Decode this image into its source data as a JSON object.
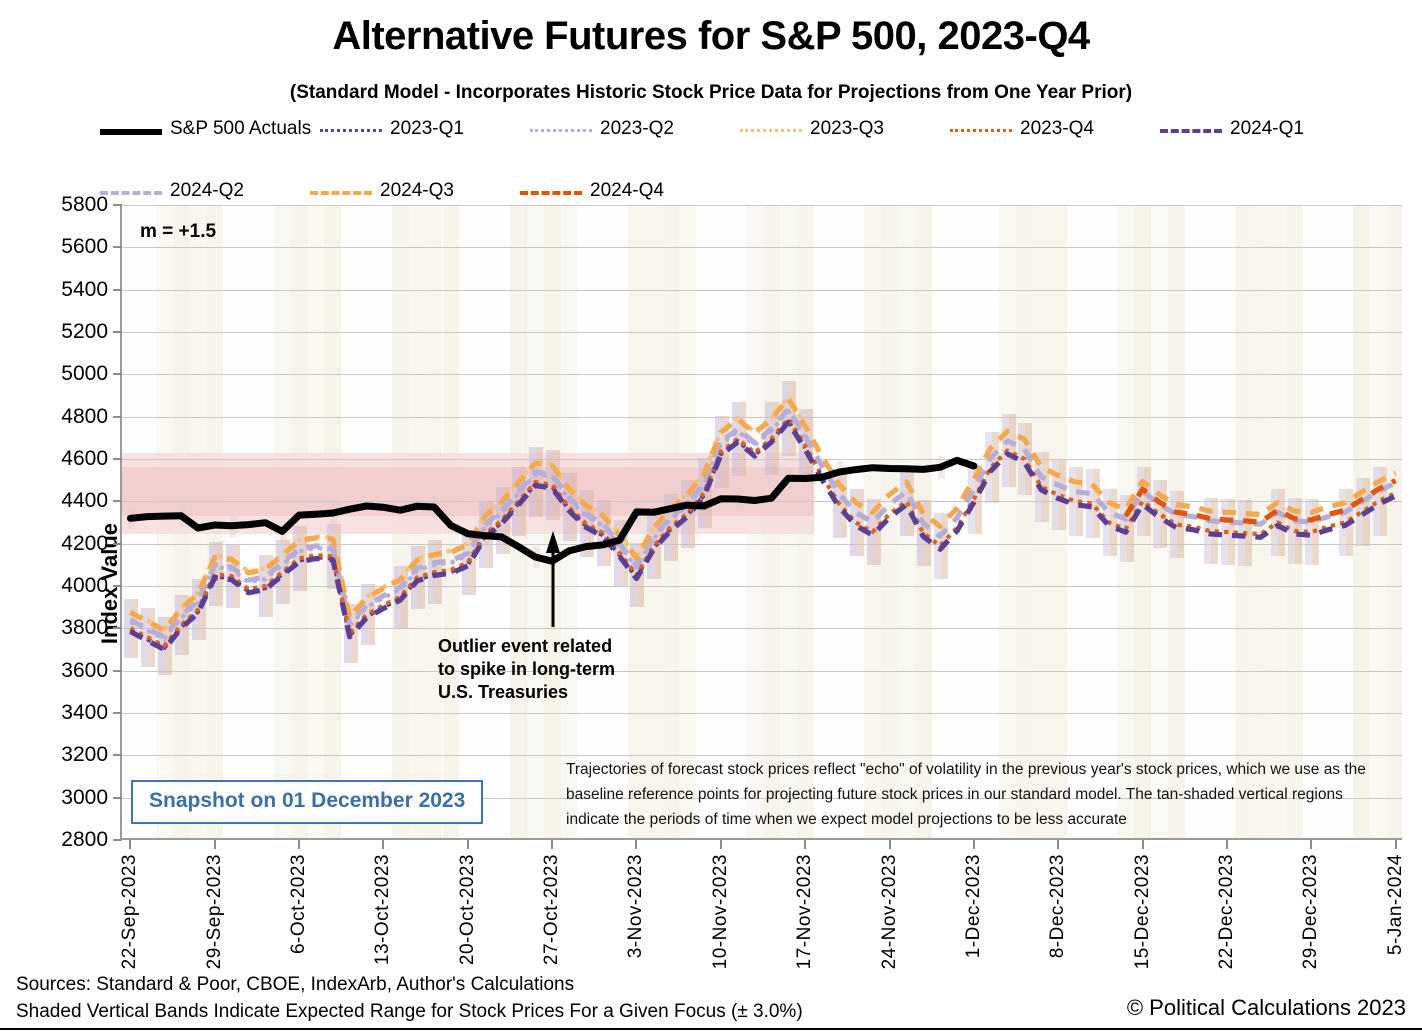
{
  "header": {
    "title": "Alternative Futures for S&P 500, 2023-Q4",
    "subtitle": "(Standard Model - Incorporates Historic Stock Price Data for Projections from One Year Prior)"
  },
  "legend": {
    "rows": [
      [
        {
          "label": "S&P 500 Actuals",
          "color": "#000000",
          "style": "solid",
          "width": 6
        },
        {
          "label": "2023-Q1",
          "color": "#5b3e96",
          "style": "dotted",
          "width": 3
        },
        {
          "label": "2023-Q2",
          "color": "#b5aedb",
          "style": "dotted",
          "width": 3
        },
        {
          "label": "2023-Q3",
          "color": "#f7c177",
          "style": "dotted",
          "width": 3
        },
        {
          "label": "2023-Q4",
          "color": "#e2600e",
          "style": "dotted",
          "width": 3
        },
        {
          "label": "2024-Q1",
          "color": "#5b3e96",
          "style": "dashed",
          "width": 4
        }
      ],
      [
        {
          "label": "2024-Q2",
          "color": "#b5aedb",
          "style": "dashed",
          "width": 4
        },
        {
          "label": "2024-Q3",
          "color": "#f5a84e",
          "style": "dashed",
          "width": 4
        },
        {
          "label": "2024-Q4",
          "color": "#e2540c",
          "style": "dashed",
          "width": 4
        }
      ]
    ]
  },
  "annotations": {
    "slope_label": "m = +1.5",
    "callout": "Outlier event related\nto spike in long-term\nU.S. Treasuries",
    "callout_line1": "Outlier event related",
    "callout_line2": "to spike in long-term",
    "callout_line3": "U.S. Treasuries",
    "snapshot": "Snapshot on 01 December 2023",
    "note": "Trajectories of forecast stock prices reflect \"echo\" of volatility in  the previous year's stock prices, which we use as the baseline reference points for projecting future stock prices in our standard model.   The tan-shaded vertical regions indicate the periods of time when we expect model projections to be less accurate"
  },
  "footer": {
    "line1": "Sources: Standard & Poor, CBOE, IndexArb, Author's Calculations",
    "line2": "Shaded Vertical Bands Indicate Expected Range for Stock Prices For a Given Focus (± 3.0%)",
    "copyright": "© Political Calculations 2023"
  },
  "chart_data": {
    "type": "line",
    "title": "Alternative Futures for S&P 500, 2023-Q4",
    "subtitle": "(Standard Model - Incorporates Historic Stock Price Data for Projections from One Year Prior)",
    "xlabel": "",
    "ylabel": "Index Value",
    "ylim": [
      2800,
      5800
    ],
    "yticks": [
      2800,
      3000,
      3200,
      3400,
      3600,
      3800,
      4000,
      4200,
      4400,
      4600,
      4800,
      5000,
      5200,
      5400,
      5600,
      5800
    ],
    "grid": true,
    "legend_position": "top",
    "xtick_labels": [
      "22-Sep-2023",
      "29-Sep-2023",
      "6-Oct-2023",
      "13-Oct-2023",
      "20-Oct-2023",
      "27-Oct-2023",
      "3-Nov-2023",
      "10-Nov-2023",
      "17-Nov-2023",
      "24-Nov-2023",
      "1-Dec-2023",
      "8-Dec-2023",
      "15-Dec-2023",
      "22-Dec-2023",
      "29-Dec-2023",
      "5-Jan-2024"
    ],
    "xtick_indices": [
      0,
      5,
      10,
      15,
      20,
      25,
      30,
      35,
      40,
      45,
      50,
      55,
      60,
      65,
      70,
      75
    ],
    "n_points": 76,
    "focus_band": {
      "label": "Expected range for stock prices for given focus",
      "upper": 4630,
      "lower": 4245,
      "inner_upper": 4560,
      "inner_lower": 4330,
      "x_start_index": 0,
      "x_end_index": 40,
      "color": "#f2cdcd"
    },
    "series": [
      {
        "name": "S&P 500 Actuals",
        "color": "#000000",
        "style": "solid",
        "values": [
          4320,
          4328,
          4330,
          4332,
          4274,
          4288,
          4285,
          4290,
          4299,
          4258,
          4335,
          4339,
          4345,
          4363,
          4378,
          4372,
          4358,
          4377,
          4373,
          4286,
          4247,
          4238,
          4232,
          4186,
          4137,
          4117,
          4166,
          4186,
          4194,
          4217,
          4350,
          4348,
          4365,
          4382,
          4378,
          4412,
          4411,
          4404,
          4415,
          4509,
          4508,
          4514,
          4538,
          4550,
          4559,
          4555,
          4554,
          4551,
          4561,
          4594,
          4567,
          null,
          null,
          null,
          null,
          null,
          null,
          null,
          null,
          null,
          null,
          null,
          null,
          null,
          null,
          null,
          null,
          null,
          null,
          null,
          null,
          null,
          null,
          null,
          null,
          null
        ]
      },
      {
        "name": "2023-Q1",
        "color": "#5b3e96",
        "style": "dotted",
        "values": [
          3790,
          3748,
          3707,
          3805,
          3878,
          4046,
          4037,
          3975,
          3990,
          4056,
          4120,
          4136,
          4130,
          3766,
          3856,
          3900,
          3940,
          4030,
          4055,
          4066,
          4101,
          4233,
          4300,
          4390,
          4481,
          4469,
          4362,
          4285,
          4240,
          4146,
          4041,
          4178,
          4267,
          4332,
          4430,
          4624,
          4685,
          4620,
          4686,
          4780,
          4652,
          null,
          null,
          null,
          null,
          null,
          null,
          null,
          null,
          null,
          null,
          null,
          null,
          null,
          null,
          null,
          null,
          null,
          null,
          null,
          null,
          null,
          null,
          null,
          null,
          null,
          null,
          null,
          null,
          null,
          null,
          null,
          null,
          null,
          null,
          null
        ]
      },
      {
        "name": "2023-Q2",
        "color": "#b5aedb",
        "style": "dotted",
        "values": [
          3830,
          3790,
          3748,
          3848,
          3920,
          4090,
          4080,
          4018,
          4033,
          4100,
          4164,
          4180,
          4174,
          3810,
          3900,
          3944,
          3984,
          4074,
          4099,
          4110,
          4145,
          4278,
          4346,
          4436,
          4528,
          4516,
          4408,
          4330,
          4285,
          4190,
          4085,
          4222,
          4312,
          4377,
          4476,
          4670,
          4732,
          4666,
          4733,
          4828,
          4698,
          null,
          null,
          null,
          null,
          null,
          null,
          null,
          null,
          null,
          null,
          null,
          null,
          null,
          null,
          null,
          null,
          null,
          null,
          null,
          null,
          null,
          null,
          null,
          null,
          null,
          null,
          null,
          null,
          null,
          null,
          null,
          null,
          null,
          null,
          null
        ]
      },
      {
        "name": "2023-Q3",
        "color": "#f7c177",
        "style": "dotted",
        "values": [
          3880,
          3838,
          3795,
          3896,
          3970,
          4142,
          4132,
          4068,
          4084,
          4152,
          4218,
          4234,
          4228,
          3858,
          3950,
          3995,
          4036,
          4128,
          4154,
          4165,
          4200,
          4334,
          4403,
          4494,
          4587,
          4575,
          4465,
          4386,
          4340,
          4244,
          4138,
          4277,
          4369,
          4435,
          4535,
          4731,
          4794,
          4728,
          4795,
          4892,
          4760,
          null,
          null,
          null,
          null,
          null,
          null,
          null,
          null,
          null,
          null,
          null,
          null,
          null,
          null,
          null,
          null,
          null,
          null,
          null,
          null,
          null,
          null,
          null,
          null,
          null,
          null,
          null,
          null,
          null,
          null,
          null,
          null,
          null,
          null,
          null
        ]
      },
      {
        "name": "2023-Q4",
        "color": "#e2600e",
        "style": "dotted",
        "values": [
          3800,
          3758,
          3717,
          3815,
          3888,
          4056,
          4047,
          3985,
          4000,
          4066,
          4130,
          4146,
          4140,
          3776,
          3866,
          3910,
          3950,
          4040,
          4065,
          4076,
          4111,
          4243,
          4310,
          4400,
          4491,
          4479,
          4372,
          4295,
          4250,
          4156,
          4051,
          4188,
          4277,
          4342,
          4440,
          4634,
          4695,
          4630,
          4696,
          4790,
          4662,
          4520,
          4390,
          4300,
          4255,
          4340,
          4400,
          4250,
          4190,
          4275,
          4410,
          4560,
          4640,
          4600,
          4470,
          4430,
          4400,
          4390,
          4300,
          4270,
          4400,
          4340,
          4290,
          4280,
          4260,
          4255,
          4250,
          4245,
          4300,
          4260,
          4255,
          4280,
          4300,
          4350,
          4400,
          4440
        ]
      },
      {
        "name": "2024-Q1",
        "color": "#5b3e96",
        "style": "dashed",
        "values": [
          3785,
          3742,
          3700,
          3800,
          3872,
          4040,
          4030,
          3968,
          3984,
          4050,
          4114,
          4130,
          4124,
          3760,
          3850,
          3894,
          3934,
          4024,
          4050,
          4060,
          4095,
          4227,
          4294,
          4384,
          4475,
          4463,
          4356,
          4278,
          4234,
          4140,
          4035,
          4172,
          4260,
          4326,
          4424,
          4618,
          4680,
          4614,
          4680,
          4774,
          4646,
          4504,
          4374,
          4286,
          4240,
          4324,
          4384,
          4234,
          4174,
          4260,
          4396,
          4544,
          4624,
          4584,
          4454,
          4414,
          4384,
          4374,
          4286,
          4254,
          4386,
          4324,
          4276,
          4266,
          4246,
          4240,
          4236,
          4230,
          4286,
          4246,
          4240,
          4266,
          4286,
          4336,
          4386,
          4426
        ]
      },
      {
        "name": "2024-Q2",
        "color": "#b5aedb",
        "style": "dashed",
        "values": [
          3840,
          3800,
          3758,
          3858,
          3930,
          4100,
          4090,
          4028,
          4043,
          4110,
          4174,
          4190,
          4184,
          3820,
          3910,
          3954,
          3994,
          4084,
          4109,
          4120,
          4155,
          4288,
          4356,
          4446,
          4538,
          4526,
          4418,
          4340,
          4295,
          4200,
          4095,
          4232,
          4322,
          4387,
          4486,
          4680,
          4742,
          4676,
          4743,
          4838,
          4708,
          4566,
          4436,
          4348,
          4302,
          4386,
          4446,
          4296,
          4236,
          4322,
          4458,
          4606,
          4686,
          4646,
          4516,
          4476,
          4446,
          4436,
          4348,
          4316,
          4448,
          4386,
          4338,
          4328,
          4308,
          4302,
          4298,
          4292,
          4348,
          4308,
          4302,
          4328,
          4348,
          4398,
          4448,
          4488
        ]
      },
      {
        "name": "2024-Q3",
        "color": "#f5a84e",
        "style": "dashed",
        "values": [
          3875,
          3833,
          3790,
          3891,
          3964,
          4136,
          4126,
          4062,
          4078,
          4146,
          4212,
          4228,
          4222,
          3852,
          3944,
          3989,
          4030,
          4122,
          4148,
          4159,
          4194,
          4328,
          4397,
          4488,
          4581,
          4569,
          4459,
          4380,
          4334,
          4238,
          4132,
          4271,
          4363,
          4429,
          4529,
          4725,
          4788,
          4722,
          4789,
          4886,
          4754,
          4612,
          4482,
          4394,
          4348,
          4432,
          4492,
          4342,
          4282,
          4368,
          4504,
          4652,
          4732,
          4692,
          4562,
          4522,
          4492,
          4482,
          4394,
          4362,
          4494,
          4432,
          4384,
          4374,
          4354,
          4348,
          4344,
          4338,
          4394,
          4354,
          4348,
          4374,
          4394,
          4444,
          4494,
          4534
        ]
      },
      {
        "name": "2024-Q4",
        "color": "#e2540c",
        "style": "dashed",
        "values": [
          null,
          null,
          null,
          null,
          null,
          null,
          null,
          null,
          null,
          null,
          null,
          null,
          null,
          null,
          null,
          null,
          null,
          null,
          null,
          null,
          null,
          null,
          null,
          null,
          null,
          null,
          null,
          null,
          null,
          null,
          null,
          null,
          null,
          null,
          null,
          null,
          null,
          null,
          null,
          null,
          null,
          null,
          null,
          null,
          null,
          null,
          null,
          null,
          null,
          null,
          null,
          null,
          null,
          null,
          null,
          null,
          null,
          null,
          null,
          4330,
          4458,
          4396,
          4348,
          4338,
          4318,
          4312,
          4308,
          4302,
          4358,
          4318,
          4312,
          4338,
          4358,
          4408,
          4458,
          4498
        ]
      }
    ]
  }
}
